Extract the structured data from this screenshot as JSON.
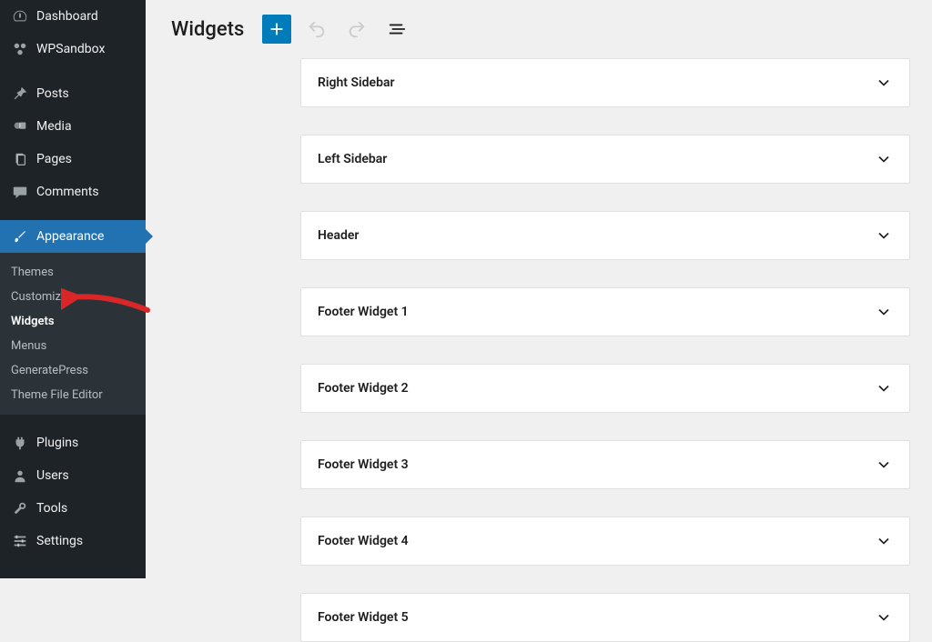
{
  "page_title": "Widgets",
  "sidebar": {
    "primary": [
      {
        "name": "dashboard",
        "label": "Dashboard",
        "icon": "dashboard-icon"
      },
      {
        "name": "wpsandbox",
        "label": "WPSandbox",
        "icon": "sandbox-icon"
      }
    ],
    "content": [
      {
        "name": "posts",
        "label": "Posts",
        "icon": "pin-icon"
      },
      {
        "name": "media",
        "label": "Media",
        "icon": "media-icon"
      },
      {
        "name": "pages",
        "label": "Pages",
        "icon": "pages-icon"
      },
      {
        "name": "comments",
        "label": "Comments",
        "icon": "comment-icon"
      }
    ],
    "appearance": {
      "label": "Appearance",
      "submenu": [
        {
          "name": "themes",
          "label": "Themes"
        },
        {
          "name": "customize",
          "label": "Customize"
        },
        {
          "name": "widgets",
          "label": "Widgets",
          "current": true
        },
        {
          "name": "menus",
          "label": "Menus"
        },
        {
          "name": "generatepress",
          "label": "GeneratePress"
        },
        {
          "name": "theme-file-editor",
          "label": "Theme File Editor"
        }
      ]
    },
    "admin": [
      {
        "name": "plugins",
        "label": "Plugins",
        "icon": "plug-icon"
      },
      {
        "name": "users",
        "label": "Users",
        "icon": "user-icon"
      },
      {
        "name": "tools",
        "label": "Tools",
        "icon": "wrench-icon"
      },
      {
        "name": "settings",
        "label": "Settings",
        "icon": "sliders-icon"
      }
    ]
  },
  "widget_areas": [
    {
      "name": "right-sidebar",
      "label": "Right Sidebar"
    },
    {
      "name": "left-sidebar",
      "label": "Left Sidebar"
    },
    {
      "name": "header",
      "label": "Header"
    },
    {
      "name": "footer-widget-1",
      "label": "Footer Widget 1"
    },
    {
      "name": "footer-widget-2",
      "label": "Footer Widget 2"
    },
    {
      "name": "footer-widget-3",
      "label": "Footer Widget 3"
    },
    {
      "name": "footer-widget-4",
      "label": "Footer Widget 4"
    },
    {
      "name": "footer-widget-5",
      "label": "Footer Widget 5"
    }
  ]
}
